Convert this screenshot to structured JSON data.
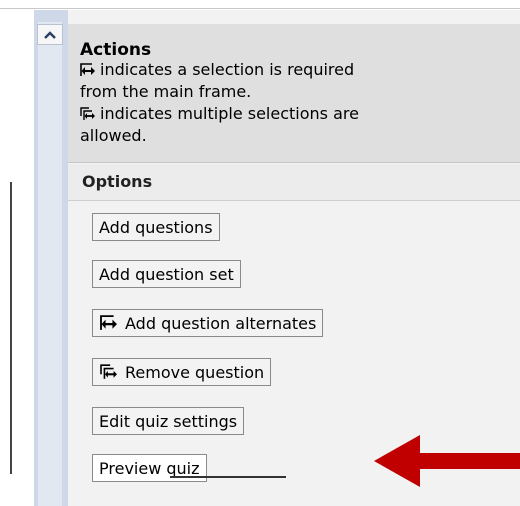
{
  "actions": {
    "title": "Actions",
    "line1": "indicates a selection is required",
    "line2": "from the main frame.",
    "line3": "indicates multiple selections are",
    "line4": "allowed."
  },
  "options": {
    "label": "Options",
    "buttons": [
      {
        "label": "Add questions",
        "icon": ""
      },
      {
        "label": "Add question set",
        "icon": ""
      },
      {
        "label": "Add question alternates",
        "icon": "single-selection-icon"
      },
      {
        "label": "Remove question",
        "icon": "multi-selection-icon"
      },
      {
        "label": "Edit quiz settings",
        "icon": ""
      },
      {
        "label": "Preview quiz",
        "icon": ""
      }
    ]
  },
  "colors": {
    "accent_arrow": "#c00000",
    "header_bg": "#dfdfdf",
    "panel_bg": "#f2f2f2",
    "strip_bg": "#cfd8e8"
  }
}
